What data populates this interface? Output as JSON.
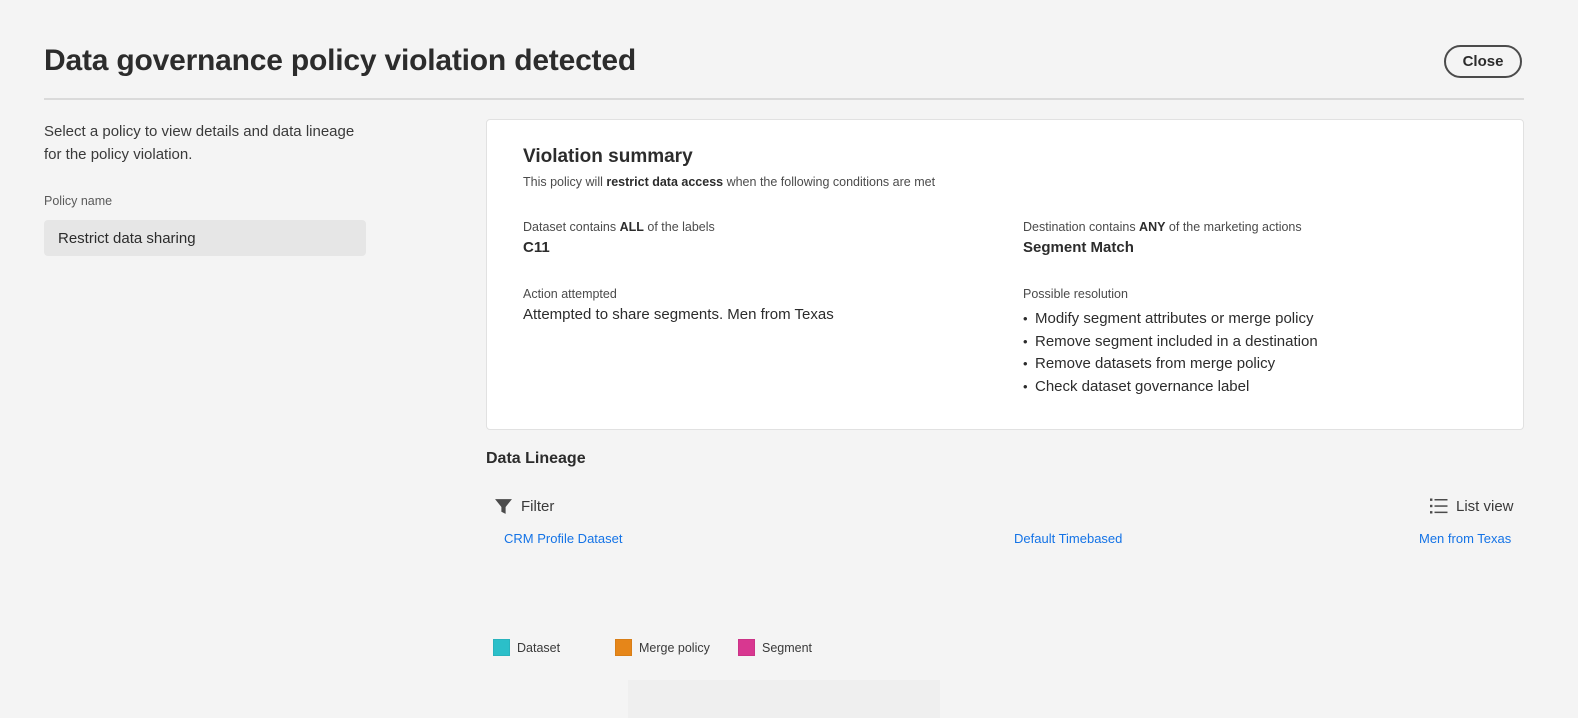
{
  "dialog": {
    "title": "Data governance policy violation detected",
    "close_label": "Close"
  },
  "sidebar": {
    "intro": "Select a policy to view details and data lineage for the policy violation.",
    "policy_label": "Policy name",
    "policy_value": "Restrict data sharing"
  },
  "summary": {
    "title": "Violation summary",
    "desc_prefix": "This policy will ",
    "desc_bold": "restrict data access",
    "desc_suffix": " when the following conditions are met",
    "dataset_label_prefix": "Dataset contains ",
    "dataset_label_bold": "ALL",
    "dataset_label_suffix": " of the labels",
    "dataset_value": "C11",
    "destination_label_prefix": "Destination contains ",
    "destination_label_bold": "ANY",
    "destination_label_suffix": " of the marketing actions",
    "destination_value": "Segment Match",
    "action_label": "Action attempted",
    "action_value": "Attempted to share segments. Men from Texas",
    "resolution_label": "Possible resolution",
    "resolutions": [
      "Modify segment attributes or merge policy",
      "Remove segment included in a destination",
      "Remove datasets from merge policy",
      "Check dataset governance label"
    ]
  },
  "lineage": {
    "title": "Data Lineage",
    "filter_label": "Filter",
    "list_view_label": "List view",
    "nodes": [
      "CRM Profile Dataset",
      "Default Timebased",
      "Men from Texas"
    ],
    "legend": [
      {
        "label": "Dataset",
        "color": "#2bbfc9"
      },
      {
        "label": "Merge policy",
        "color": "#e68619"
      },
      {
        "label": "Segment",
        "color": "#d83790"
      }
    ]
  },
  "colors": {
    "link": "#1473e6",
    "background": "#f4f4f4",
    "card": "#ffffff"
  }
}
